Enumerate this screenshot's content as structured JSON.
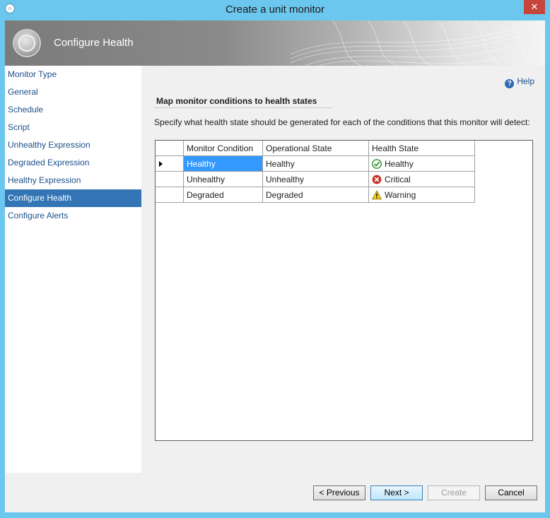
{
  "window": {
    "title": "Create a unit monitor",
    "close_label": "✕"
  },
  "banner": {
    "title": "Configure Health"
  },
  "sidebar": {
    "items": [
      {
        "label": "Monitor Type",
        "active": false
      },
      {
        "label": "General",
        "active": false
      },
      {
        "label": "Schedule",
        "active": false
      },
      {
        "label": "Script",
        "active": false
      },
      {
        "label": "Unhealthy Expression",
        "active": false
      },
      {
        "label": "Degraded Expression",
        "active": false
      },
      {
        "label": "Healthy Expression",
        "active": false
      },
      {
        "label": "Configure Health",
        "active": true
      },
      {
        "label": "Configure Alerts",
        "active": false
      }
    ]
  },
  "main": {
    "help_label": "Help",
    "section_title": "Map monitor conditions to health states",
    "description": "Specify what health state should be generated for each of the conditions that this monitor will detect:",
    "grid": {
      "columns": [
        "Monitor Condition",
        "Operational State",
        "Health State"
      ],
      "rows": [
        {
          "condition": "Healthy",
          "operational_state": "Healthy",
          "health_state": "Healthy",
          "icon": "check-circle-icon",
          "selected": true
        },
        {
          "condition": "Unhealthy",
          "operational_state": "Unhealthy",
          "health_state": "Critical",
          "icon": "error-circle-icon",
          "selected": false
        },
        {
          "condition": "Degraded",
          "operational_state": "Degraded",
          "health_state": "Warning",
          "icon": "warning-triangle-icon",
          "selected": false
        }
      ]
    }
  },
  "footer": {
    "previous_label": "< Previous",
    "next_label": "Next >",
    "create_label": "Create",
    "cancel_label": "Cancel"
  },
  "colors": {
    "title_bar": "#6cc7ef",
    "nav_selected": "#3375b5",
    "cell_selected": "#3399ff",
    "link": "#1d4f8c"
  }
}
